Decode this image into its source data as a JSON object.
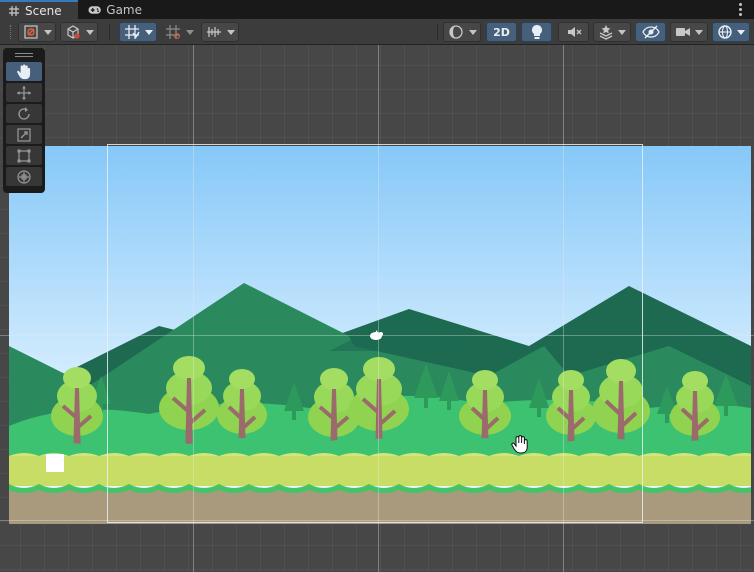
{
  "window": {
    "tabs": [
      {
        "label": "Scene",
        "icon": "grid-icon",
        "active": true
      },
      {
        "label": "Game",
        "icon": "gamepad-icon",
        "active": false
      }
    ]
  },
  "toolbar": {
    "mode_2d_label": "2D",
    "accent_color": "#46607c"
  },
  "tools": [
    {
      "name": "hand-tool",
      "icon": "hand-icon",
      "active": true
    },
    {
      "name": "move-tool",
      "icon": "move-arrows-icon",
      "active": false
    },
    {
      "name": "rotate-tool",
      "icon": "rotate-icon",
      "active": false
    },
    {
      "name": "scale-tool",
      "icon": "scale-icon",
      "active": false
    },
    {
      "name": "rect-tool",
      "icon": "rect-transform-icon",
      "active": false
    },
    {
      "name": "transform-tool",
      "icon": "transform-icon",
      "active": false
    }
  ],
  "scene": {
    "sky_top_color": "#86c8f8",
    "sky_bottom_color": "#ddf1ff",
    "grass_color": "#c8dd66",
    "dirt_color": "#a99a7e"
  }
}
